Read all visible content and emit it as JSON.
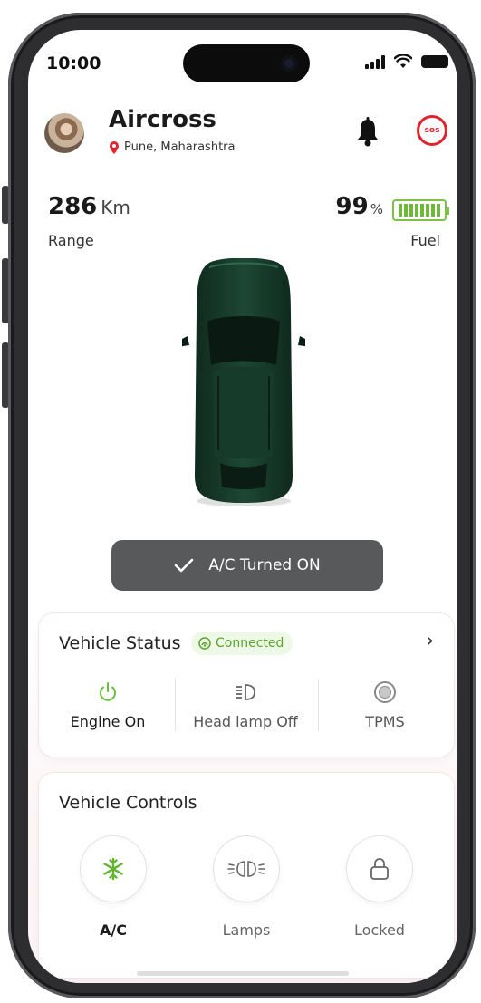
{
  "status_bar": {
    "time": "10:00"
  },
  "header": {
    "car_name": "Aircross",
    "location": "Pune, Maharashtra",
    "sos_label": "SOS"
  },
  "metrics": {
    "range": {
      "value": "286",
      "unit": "Km",
      "label": "Range"
    },
    "fuel": {
      "value": "99",
      "unit": "%",
      "label": "Fuel",
      "level_percent": 99
    }
  },
  "toast": {
    "message": "A/C Turned ON"
  },
  "vehicle_status": {
    "title": "Vehicle Status",
    "badge": "Connected",
    "items": [
      {
        "label": "Engine On",
        "icon": "power-icon",
        "color": "#6abf3a"
      },
      {
        "label": "Head lamp Off",
        "icon": "headlamp-icon",
        "color": "#666666"
      },
      {
        "label": "TPMS",
        "icon": "tpms-icon",
        "color": "#666666"
      }
    ]
  },
  "vehicle_controls": {
    "title": "Vehicle Controls",
    "items": [
      {
        "label": "A/C",
        "icon": "snowflake-icon",
        "active": true
      },
      {
        "label": "Lamps",
        "icon": "lamps-icon",
        "active": false
      },
      {
        "label": "Locked",
        "icon": "lock-icon",
        "active": false
      }
    ]
  },
  "colors": {
    "accent_green": "#6abf3a",
    "sos_red": "#e3232c",
    "car_body": "#163a2a"
  }
}
